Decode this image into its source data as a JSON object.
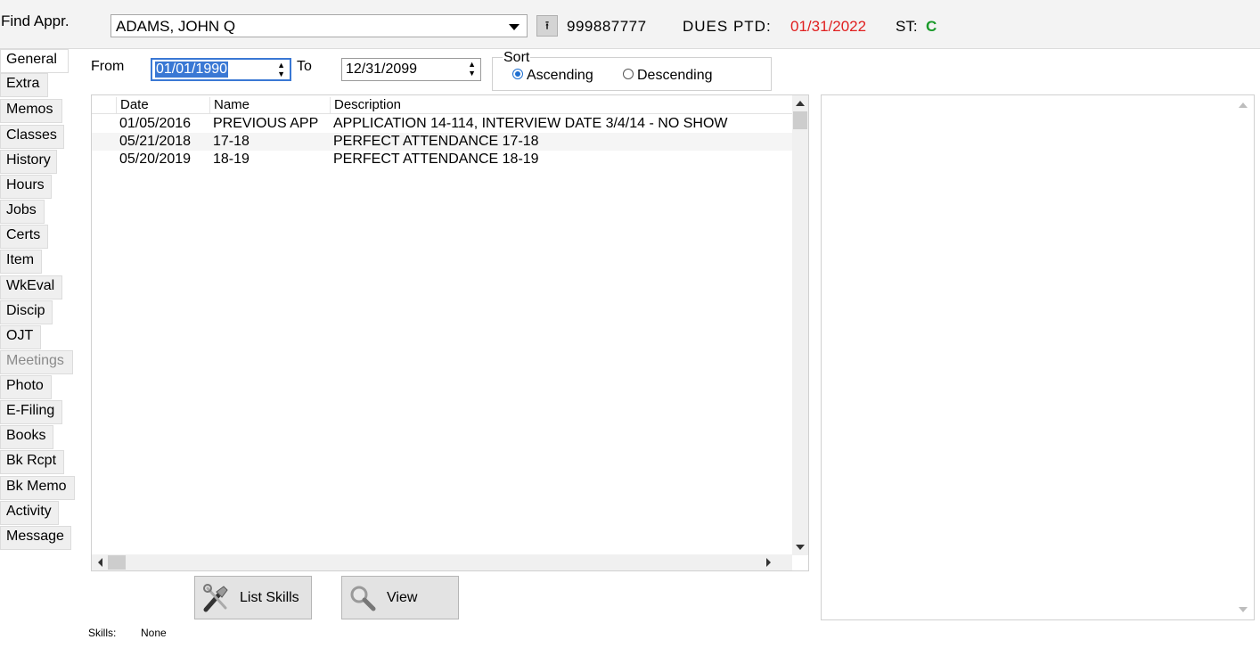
{
  "header": {
    "find_label": "Find Appr.",
    "member_name": "ADAMS, JOHN Q",
    "member_id": "999887777",
    "dues_label": "DUES PTD:",
    "dues_date": "01/31/2022",
    "status_label": "ST:",
    "status_value": "C",
    "colors": {
      "dues_date": "#e02020",
      "status_value": "#1a9a2a"
    }
  },
  "tabs": [
    {
      "label": "General"
    },
    {
      "label": "Extra"
    },
    {
      "label": "Memos"
    },
    {
      "label": "Classes"
    },
    {
      "label": "History"
    },
    {
      "label": "Hours"
    },
    {
      "label": "Jobs"
    },
    {
      "label": "Certs"
    },
    {
      "label": "Item"
    },
    {
      "label": "WkEval"
    },
    {
      "label": "Discip"
    },
    {
      "label": "OJT"
    },
    {
      "label": "Meetings"
    },
    {
      "label": "Photo"
    },
    {
      "label": "E-Filing"
    },
    {
      "label": "Books"
    },
    {
      "label": "Bk Rcpt"
    },
    {
      "label": "Bk Memo"
    },
    {
      "label": "Activity"
    },
    {
      "label": "Message"
    }
  ],
  "filter": {
    "from_label": "From",
    "from_value": "01/01/1990",
    "to_label": "To",
    "to_value": "12/31/2099",
    "sort_label": "Sort",
    "ascending_label": "Ascending",
    "descending_label": "Descending",
    "selected": "Ascending"
  },
  "list": {
    "columns": [
      "Date",
      "Name",
      "Description"
    ],
    "rows": [
      {
        "date": "01/05/2016",
        "name": "PREVIOUS APP",
        "description": "APPLICATION 14-114, INTERVIEW DATE 3/4/14 - NO SHOW"
      },
      {
        "date": "05/21/2018",
        "name": "17-18",
        "description": "PERFECT ATTENDANCE 17-18"
      },
      {
        "date": "05/20/2019",
        "name": "18-19",
        "description": "PERFECT ATTENDANCE 18-19"
      }
    ]
  },
  "actions": {
    "list_skills_label": "List Skills",
    "view_label": "View"
  },
  "footer": {
    "skills_label": "Skills:",
    "skills_value": "None"
  },
  "icons": {
    "upload": "upload-arrow-icon",
    "list_skills": "tools-icon",
    "view": "magnifier-icon"
  }
}
